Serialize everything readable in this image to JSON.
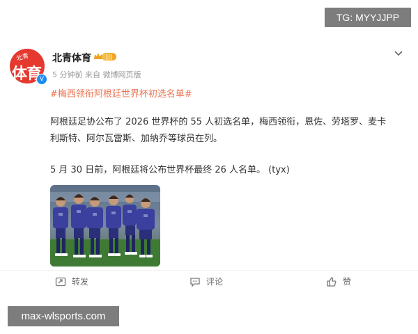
{
  "overlay": {
    "tg_label": "TG: MYYJJPP",
    "site_label": "max-wlsports.com"
  },
  "post": {
    "avatar_small_text": "北青",
    "avatar_big_text": "体育",
    "username": "北青体育",
    "badge_text": "V",
    "meta": "5 分钟前  来自 微博网页版",
    "hashtag": "#梅西领衔阿根廷世界杯初选名单#",
    "body_line1": "阿根廷足协公布了 2026 世界杯的 55 人初选名单，梅西领衔，恩佐、劳塔罗、麦卡",
    "body_line2": "利斯特、阿尔瓦雷斯、加纳乔等球员在列。",
    "body_line3": "5 月 30 日前，阿根廷将公布世界杯最终 26 人名单。  (tyx)"
  },
  "actions": {
    "repost": "转发",
    "comment": "评论",
    "like": "赞"
  },
  "colors": {
    "hashtag": "#eb7350",
    "avatar": "#e5392f",
    "verified": "#1d8cf0",
    "jersey": "#3b3f9e"
  }
}
